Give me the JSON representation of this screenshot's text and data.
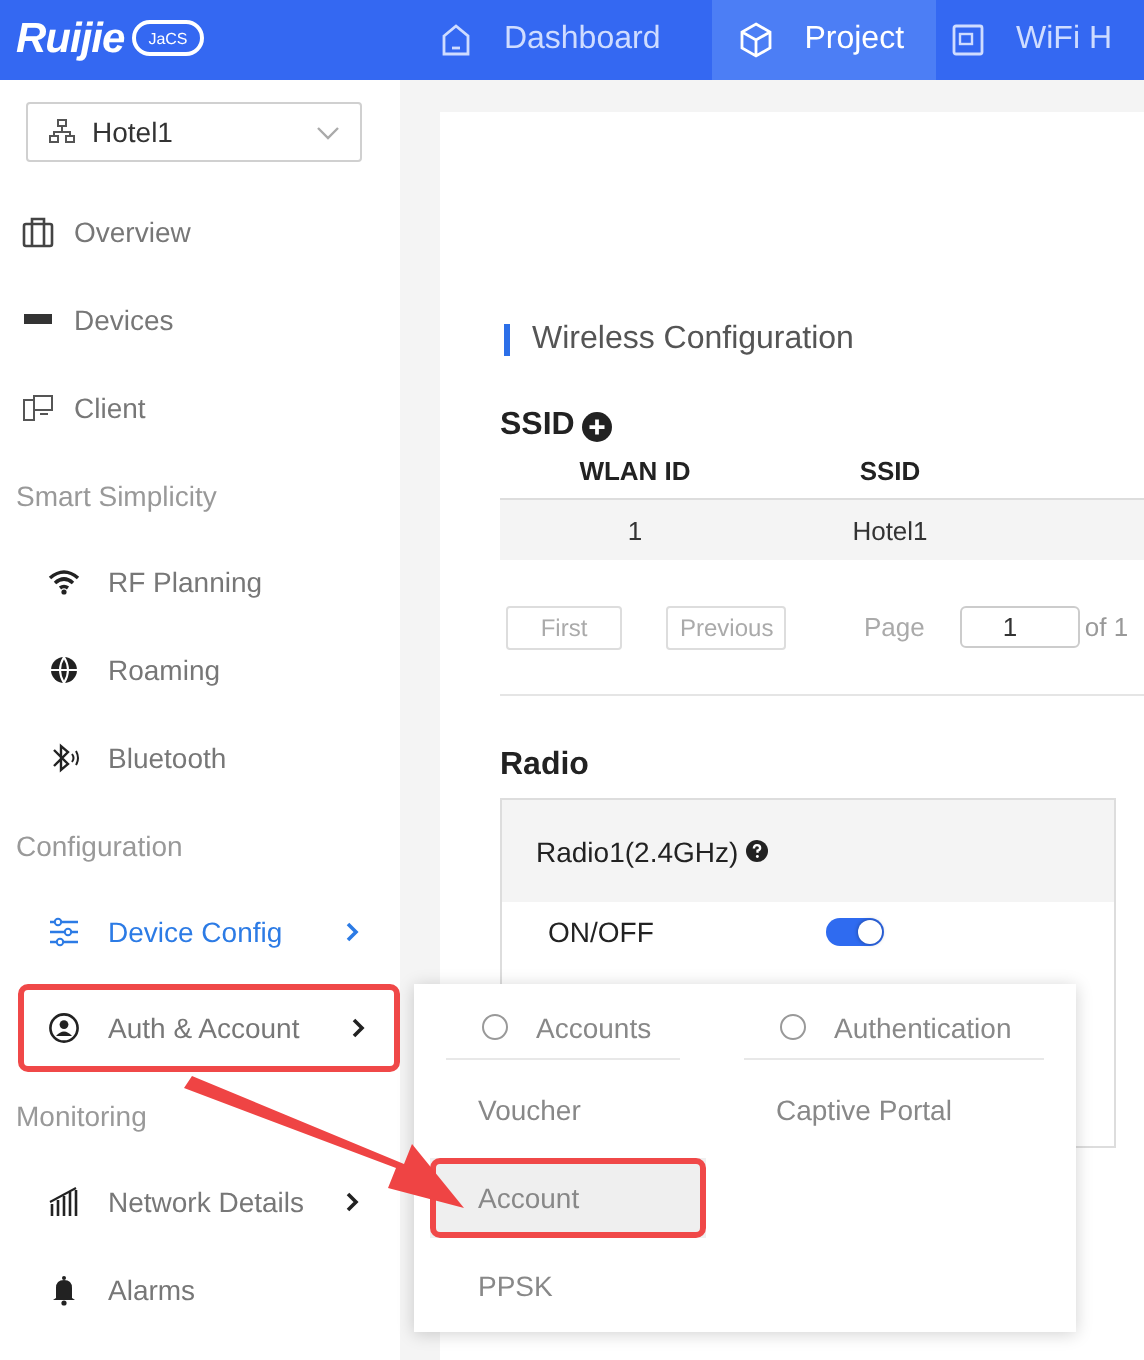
{
  "logo": {
    "brand": "Ruijie",
    "product": "JaCS"
  },
  "nav_tabs": [
    {
      "label": "Dashboard",
      "selected": false
    },
    {
      "label": "Project",
      "selected": true
    },
    {
      "label": "WiFi H",
      "selected": false
    }
  ],
  "site_selector": {
    "value": "Hotel1"
  },
  "sidebar": {
    "items": [
      {
        "kind": "item",
        "label": "Overview",
        "selected": false,
        "submenu": false,
        "annotated": false,
        "indented": false
      },
      {
        "kind": "item",
        "label": "Devices",
        "selected": false,
        "submenu": false,
        "annotated": false,
        "indented": false
      },
      {
        "kind": "item",
        "label": "Client",
        "selected": false,
        "submenu": false,
        "annotated": false,
        "indented": false
      },
      {
        "kind": "heading",
        "label": "Smart Simplicity"
      },
      {
        "kind": "item",
        "label": "RF Planning",
        "selected": false,
        "submenu": false,
        "annotated": false,
        "indented": true
      },
      {
        "kind": "item",
        "label": "Roaming",
        "selected": false,
        "submenu": false,
        "annotated": false,
        "indented": true
      },
      {
        "kind": "item",
        "label": "Bluetooth",
        "selected": false,
        "submenu": false,
        "annotated": false,
        "indented": true
      },
      {
        "kind": "heading",
        "label": "Configuration"
      },
      {
        "kind": "item",
        "label": "Device Config",
        "selected": true,
        "submenu": true,
        "annotated": false,
        "indented": true
      },
      {
        "kind": "item",
        "label": "Auth & Account",
        "selected": false,
        "submenu": true,
        "annotated": true,
        "indented": true
      },
      {
        "kind": "heading",
        "label": "Monitoring"
      },
      {
        "kind": "item",
        "label": "Network Details",
        "selected": false,
        "submenu": true,
        "annotated": false,
        "indented": true
      },
      {
        "kind": "item",
        "label": "Alarms",
        "selected": false,
        "submenu": false,
        "annotated": false,
        "indented": true
      }
    ]
  },
  "main": {
    "section_title": "Wireless Configuration",
    "ssid": {
      "title": "SSID",
      "table": {
        "columns": [
          "WLAN ID",
          "SSID"
        ],
        "rows": [
          [
            "1",
            "Hotel1"
          ]
        ]
      },
      "pagination": {
        "first": "First",
        "previous": "Previous",
        "page_label": "Page",
        "page_value": "1",
        "of_label": "of 1"
      }
    },
    "radio": {
      "title": "Radio",
      "panel_title": "Radio1(2.4GHz)",
      "rows": [
        {
          "label": "ON/OFF",
          "on": true
        }
      ]
    }
  },
  "flyout_menu": {
    "columns": [
      {
        "heading": "Accounts",
        "selected": false,
        "items": [
          {
            "label": "Voucher",
            "hovered": false,
            "annotated": false
          },
          {
            "label": "Account",
            "hovered": true,
            "annotated": true
          },
          {
            "label": "PPSK",
            "hovered": false,
            "annotated": false
          }
        ]
      },
      {
        "heading": "Authentication",
        "selected": false,
        "items": [
          {
            "label": "Captive Portal",
            "hovered": false,
            "annotated": false
          }
        ]
      }
    ]
  }
}
